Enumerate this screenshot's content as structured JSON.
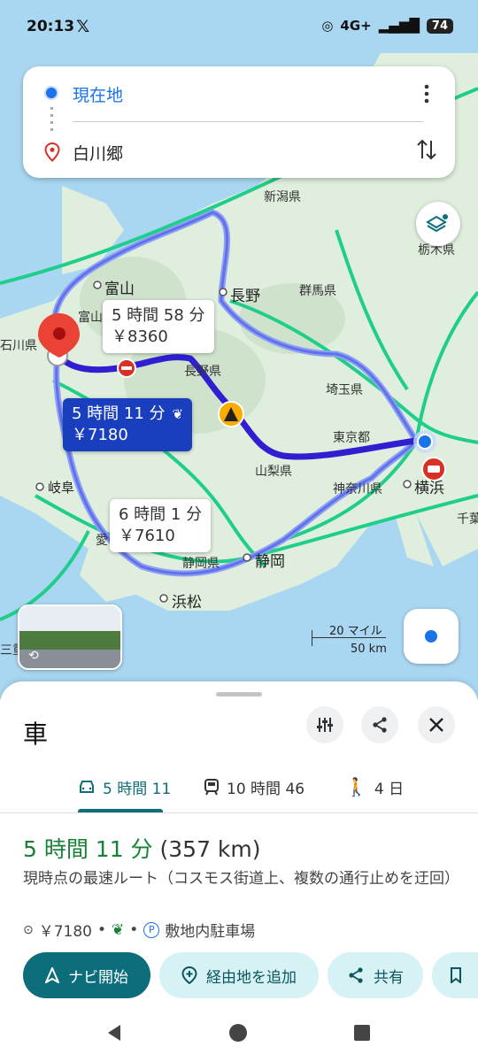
{
  "status_bar": {
    "time": "20:13",
    "x_logo": "𝕏",
    "network": "4G+",
    "battery": "74"
  },
  "search": {
    "origin": "現在地",
    "destination": "白川郷"
  },
  "map": {
    "places": [
      {
        "name": "新潟県"
      },
      {
        "name": "栃木県"
      },
      {
        "name": "群馬県"
      },
      {
        "name": "富山"
      },
      {
        "name": "長野"
      },
      {
        "name": "埼玉県"
      },
      {
        "name": "長野県"
      },
      {
        "name": "東京都"
      },
      {
        "name": "山梨県"
      },
      {
        "name": "神奈川県"
      },
      {
        "name": "横浜"
      },
      {
        "name": "千葉"
      },
      {
        "name": "岐阜"
      },
      {
        "name": "愛"
      },
      {
        "name": "静岡県"
      },
      {
        "name": "静岡"
      },
      {
        "name": "浜松"
      },
      {
        "name": "富山"
      },
      {
        "name": "石川県"
      },
      {
        "name": "三重"
      }
    ],
    "routes": [
      {
        "duration": "5 時間 58 分",
        "toll": "￥8360",
        "selected": false
      },
      {
        "duration": "5 時間 11 分",
        "toll": "￥7180",
        "selected": true,
        "eco": true
      },
      {
        "duration": "6 時間 1 分",
        "toll": "￥7610",
        "selected": false
      }
    ],
    "scale_miles": "20 マイル",
    "scale_km": "50 km",
    "colors": {
      "route_selected": "#2f1fd1",
      "route_alt": "#8fa0f4",
      "highway": "#1fce8a",
      "land": "#dfeedd",
      "water": "#a9d7f2"
    }
  },
  "sheet": {
    "title": "車",
    "tabs": [
      {
        "icon": "car-icon",
        "label": "5 時間 11",
        "active": true
      },
      {
        "icon": "train-icon",
        "label": "10 時間 46",
        "active": false
      },
      {
        "icon": "walk-icon",
        "label": "4 日",
        "active": false
      }
    ],
    "duration": "5 時間 11 分",
    "distance": "(357 km)",
    "description": "現時点の最速ルート（コスモス街道上、複数の通行止めを迂回）",
    "toll": "￥7180",
    "parking": "敷地内駐車場",
    "actions": {
      "start_nav": "ナビ開始",
      "add_stop": "経由地を追加",
      "share": "共有"
    },
    "accent_color": "#0b6e7a"
  }
}
